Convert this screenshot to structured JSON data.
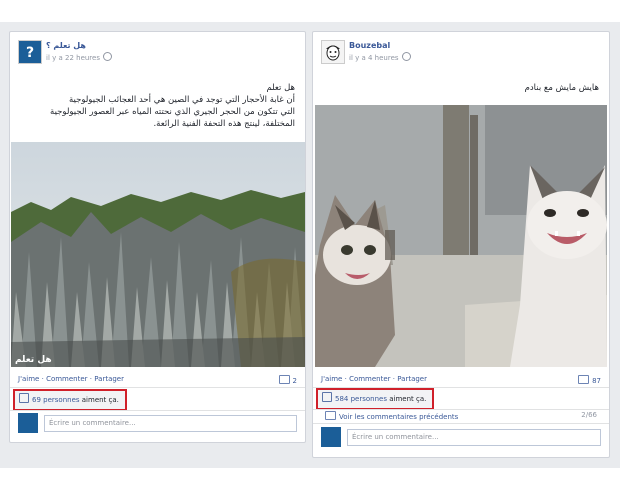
{
  "posts": [
    {
      "author": "هل تعلم ؟",
      "time": "il y a 22 heures",
      "text": "هل تعلم\nأن غابة الأحجار التي توجد في الصين هي أحد العجائب الجيولوجية\nالتي تتكون من الحجر الجيري الذي نحتته المياه عبر العصور الجيولوجية\nالمختلفة، لينتج هذه التحفة الفنية الرائعة.",
      "photo_caption": "هل تعلم",
      "actions": {
        "like": "J'aime",
        "comment": "Commenter",
        "share": "Partager",
        "sep": "·"
      },
      "comment_count": "2",
      "likes_link": "69 personnes",
      "likes_suffix": "aiment ça.",
      "comment_placeholder": "Écrire un commentaire..."
    },
    {
      "author": "Bouzebal",
      "time": "il y a 4 heures",
      "text": "هايش مايش مع بنادم",
      "actions": {
        "like": "J'aime",
        "comment": "Commenter",
        "share": "Partager",
        "sep": "·"
      },
      "comment_count": "87",
      "likes_link": "584 personnes",
      "likes_suffix": "aiment ça.",
      "prev_comments": "Voir les commentaires précédents",
      "prev_pages": "2/66",
      "comment_placeholder": "Écrire un commentaire..."
    }
  ],
  "colors": {
    "link": "#3b5998",
    "highlight_border": "#d0202a",
    "background": "#e9ebee"
  }
}
